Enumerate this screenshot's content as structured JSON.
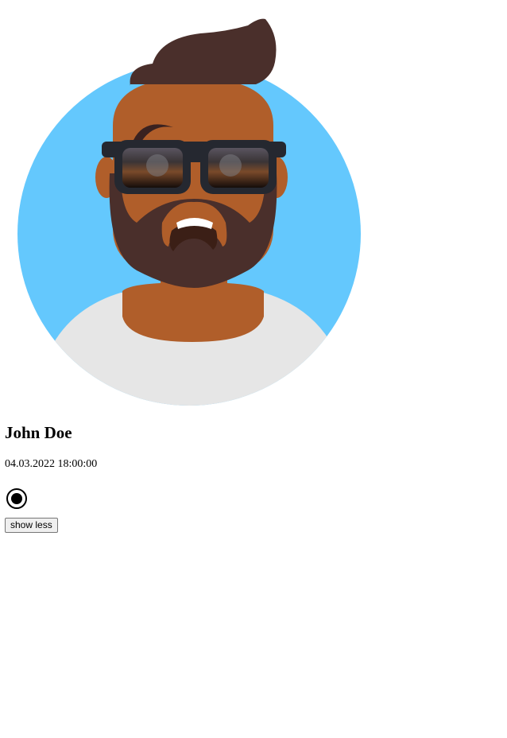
{
  "profile": {
    "name": "John Doe",
    "timestamp": "04.03.2022 18:00:00",
    "radio_selected": true,
    "toggle_label": "show less"
  },
  "avatar": {
    "icon": "person-avatar-illustration",
    "background_color": "#64c8fd",
    "skin_color": "#b05e2a",
    "hair_color": "#4a2f2b",
    "shirt_color": "#e6e6e6",
    "glasses_color": "#252830"
  }
}
